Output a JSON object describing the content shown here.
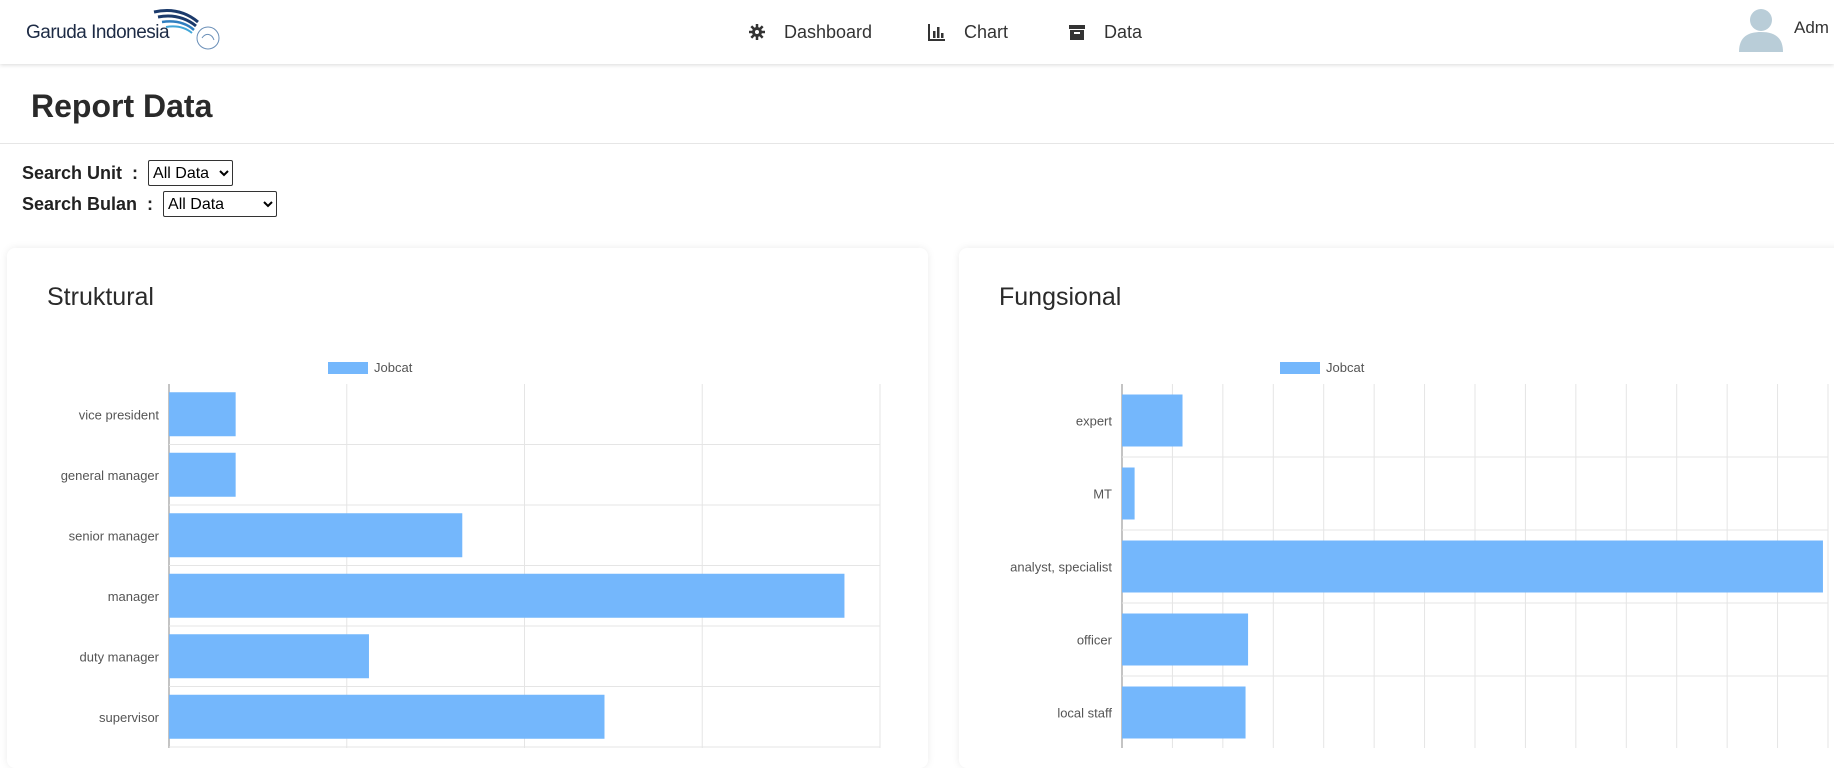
{
  "brand": {
    "name": "Garuda Indonesia"
  },
  "nav": {
    "dashboard": "Dashboard",
    "chart": "Chart",
    "data": "Data"
  },
  "user": {
    "name": "Adm"
  },
  "page": {
    "title": "Report Data"
  },
  "filters": {
    "unit_label": "Search Unit",
    "unit_value": "All Data",
    "bulan_label": "Search Bulan",
    "bulan_value": "All Data",
    "colon": ":"
  },
  "colors": {
    "bar": "#74b7fc",
    "grid": "#e5e5e5",
    "axis": "#888888"
  },
  "chart_data": [
    {
      "type": "bar",
      "orientation": "horizontal",
      "title": "Struktural",
      "categories": [
        "vice president",
        "general manager",
        "senior manager",
        "manager",
        "duty manager",
        "supervisor"
      ],
      "series": [
        {
          "name": "Jobcat",
          "values": [
            1.5,
            1.5,
            6.6,
            15.2,
            4.5,
            9.8
          ]
        }
      ],
      "xlim": [
        0,
        16
      ],
      "legend": "top-center",
      "grid": true
    },
    {
      "type": "bar",
      "orientation": "horizontal",
      "title": "Fungsional",
      "categories": [
        "expert",
        "MT",
        "analyst, specialist",
        "officer",
        "local staff"
      ],
      "series": [
        {
          "name": "Jobcat",
          "values": [
            12,
            2.5,
            139,
            25,
            24.5
          ]
        }
      ],
      "xlim": [
        0,
        140
      ],
      "legend": "top-center",
      "grid": true
    }
  ]
}
